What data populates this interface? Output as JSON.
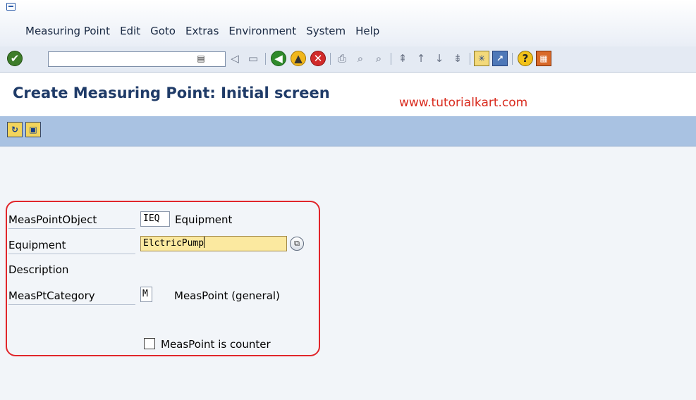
{
  "menu": {
    "items": [
      "Measuring Point",
      "Edit",
      "Goto",
      "Extras",
      "Environment",
      "System",
      "Help"
    ]
  },
  "toolbar": {
    "command_value": "",
    "icons": [
      "enter-icon",
      "back-icon",
      "save-icon",
      "green-back-icon",
      "exit-icon",
      "cancel-icon",
      "print-icon",
      "find-icon",
      "find-next-icon",
      "first-page-icon",
      "previous-page-icon",
      "next-page-icon",
      "last-page-icon",
      "new-session-icon",
      "shortcut-icon",
      "help-icon",
      "layout-icon"
    ]
  },
  "title": {
    "text": "Create Measuring Point: Initial screen",
    "watermark": "www.tutorialkart.com"
  },
  "form": {
    "meas_point_object_label": "MeasPointObject",
    "meas_point_object_value": "IEQ",
    "meas_point_object_text": "Equipment",
    "equipment_label": "Equipment",
    "equipment_value": "ElctricPump",
    "description_label": "Description",
    "category_label": "MeasPtCategory",
    "category_value": "M",
    "category_text": "MeasPoint (general)",
    "counter_label": "MeasPoint is counter",
    "counter_checked": false
  },
  "colors": {
    "title": "#1f3b68",
    "watermark": "#d92b1e",
    "frame_highlight": "#e1262b",
    "focused_field": "#fbe9a0",
    "app_toolbar": "#a9c2e2"
  }
}
